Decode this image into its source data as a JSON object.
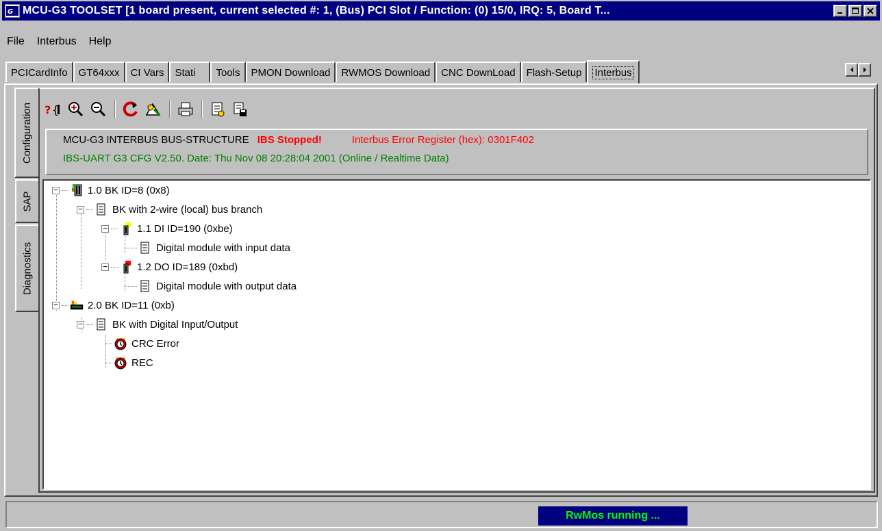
{
  "window": {
    "title": "MCU-G3 TOOLSET [1 board present, current selected #: 1, (Bus) PCI Slot / Function: (0) 15/0, IRQ: 5, Board T...",
    "icon": "app-icon"
  },
  "menu": {
    "file": "File",
    "interbus": "Interbus",
    "help": "Help"
  },
  "tabs": [
    {
      "label": "PCICardInfo"
    },
    {
      "label": "GT64xxx"
    },
    {
      "label": "CI Vars"
    },
    {
      "label": "Stati"
    },
    {
      "label": "Tools"
    },
    {
      "label": "PMON Download"
    },
    {
      "label": "RWMOS Download"
    },
    {
      "label": "CNC DownLoad"
    },
    {
      "label": "Flash-Setup"
    },
    {
      "label": "Interbus"
    }
  ],
  "side_tabs": {
    "configuration": "Configuration",
    "sap": "SAP",
    "diagnostics": "Diagnostics"
  },
  "info": {
    "title": "MCU-G3 INTERBUS BUS-STRUCTURE",
    "status": "IBS Stopped!",
    "error_register": "Interbus Error Register (hex): 0301F402",
    "version": "IBS-UART G3 CFG V2.50. Date: Thu Nov 08 20:28:04 2001 (Online / Realtime Data)"
  },
  "tree": {
    "n1": "1.0 BK ID=8 (0x8)",
    "n1a": "BK with 2-wire (local) bus branch",
    "n11": "1.1 DI ID=190 (0xbe)",
    "n11a": "Digital module with input data",
    "n12": "1.2 DO ID=189 (0xbd)",
    "n12a": "Digital module with output data",
    "n2": "2.0 BK ID=11 (0xb)",
    "n2a": "BK with Digital Input/Output",
    "e1": "CRC Error",
    "e2": "REC"
  },
  "status": {
    "message": "RwMos running ..."
  },
  "colors": {
    "titlebar": "#000080",
    "error": "#ff0000",
    "version": "#008000",
    "status_text": "#00ff00",
    "status_bg": "#000080"
  }
}
